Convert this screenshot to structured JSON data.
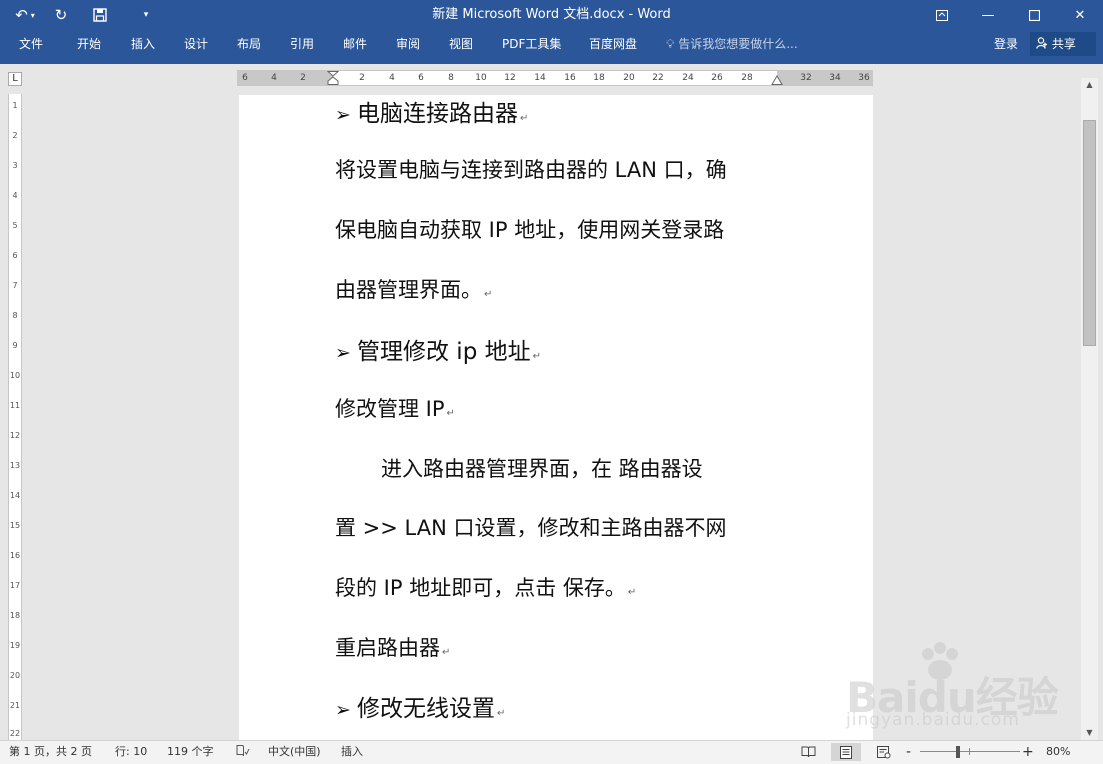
{
  "window": {
    "title": "新建 Microsoft Word 文档.docx - Word"
  },
  "quick_access": {
    "undo_icon": "undo-icon",
    "redo_icon": "redo-icon",
    "save_icon": "save-icon",
    "customize_icon": "customize-qat-icon"
  },
  "ribbon": {
    "tabs": [
      "文件",
      "开始",
      "插入",
      "设计",
      "布局",
      "引用",
      "邮件",
      "审阅",
      "视图",
      "PDF工具集",
      "百度网盘"
    ],
    "tell_me": "告诉我您想要做什么...",
    "login": "登录",
    "share": "共享"
  },
  "ruler": {
    "tab_selector": "L",
    "ticks": [
      "6",
      "4",
      "2",
      "2",
      "4",
      "6",
      "8",
      "10",
      "12",
      "14",
      "16",
      "18",
      "20",
      "22",
      "24",
      "26",
      "28",
      "32",
      "34",
      "36"
    ],
    "vticks": [
      "1",
      "2",
      "3",
      "4",
      "5",
      "6",
      "7",
      "8",
      "9",
      "10",
      "11",
      "12",
      "13",
      "14",
      "15",
      "16",
      "17",
      "18",
      "19",
      "20",
      "21",
      "22"
    ]
  },
  "document": {
    "lines": [
      {
        "text": "电脑连接路由器",
        "bullet": "➢",
        "mark": "↵"
      },
      {
        "text": "将设置电脑与连接到路由器的 LAN 口，确",
        "bullet": "",
        "mark": ""
      },
      {
        "text": "保电脑自动获取 IP 地址，使用网关登录路",
        "bullet": "",
        "mark": ""
      },
      {
        "text": "由器管理界面。",
        "bullet": "",
        "mark": "↵"
      },
      {
        "text": "管理修改 ip 地址",
        "bullet": "➢",
        "mark": "↵"
      },
      {
        "text": "修改管理 IP",
        "bullet": "",
        "mark": "↵"
      },
      {
        "text": "进入路由器管理界面，在  路由器设",
        "bullet": "",
        "mark": ""
      },
      {
        "text": "置  >> LAN 口设置，修改和主路由器不网",
        "bullet": "",
        "mark": ""
      },
      {
        "text": "段的 IP 地址即可，点击  保存。",
        "bullet": "",
        "mark": "↵"
      },
      {
        "text": "重启路由器",
        "bullet": "",
        "mark": "↵"
      },
      {
        "text": "修改无线设置",
        "bullet": "➢",
        "mark": "↵"
      }
    ]
  },
  "status": {
    "page": "第 1 页，共 2 页",
    "line": "行: 10",
    "words": "119 个字",
    "language": "中文(中国)",
    "mode": "插入",
    "zoom": "80%",
    "zoom_minus": "-",
    "zoom_plus": "+"
  },
  "watermark": {
    "brand": "Baidu经验",
    "url": "jingyan.baidu.com"
  }
}
